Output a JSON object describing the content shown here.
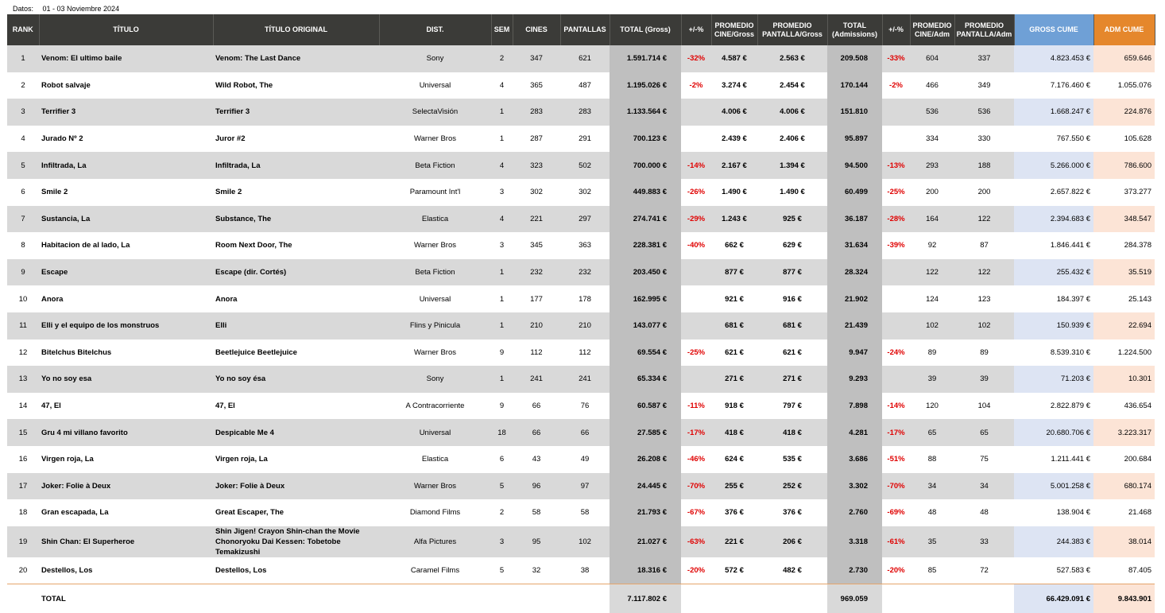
{
  "datos": {
    "label": "Datos:",
    "value": "01 - 03 Noviembre 2024"
  },
  "headers": {
    "rank": "RANK",
    "titulo": "TÍTULO",
    "original": "TÍTULO ORIGINAL",
    "dist": "DIST.",
    "sem": "SEM",
    "cines": "CINES",
    "pantallas": "PANTALLAS",
    "total_gross": "TOTAL (Gross)",
    "pct_gross": "+/-%",
    "prom_cine_gross_1": "PROMEDIO",
    "prom_cine_gross_2": "CINE/Gross",
    "prom_pant_gross_1": "PROMEDIO",
    "prom_pant_gross_2": "PANTALLA/Gross",
    "total_adm_1": "TOTAL",
    "total_adm_2": "(Admissions)",
    "pct_adm": "+/-%",
    "prom_cine_adm_1": "PROMEDIO",
    "prom_cine_adm_2": "CINE/Adm",
    "prom_pant_adm_1": "PROMEDIO",
    "prom_pant_adm_2": "PANTALLA/Adm",
    "gross_cume": "GROSS CUME",
    "adm_cume": "ADM CUME"
  },
  "rows": [
    {
      "rank": "1",
      "titulo": "Venom: El ultimo baile",
      "original": "Venom: The Last Dance",
      "dist": "Sony",
      "sem": "2",
      "cines": "347",
      "pantallas": "621",
      "gross": "1.591.714 €",
      "pct_gross": "-32%",
      "pcg": "4.587 €",
      "ppg": "2.563 €",
      "adm": "209.508",
      "pct_adm": "-33%",
      "pca": "604",
      "ppa": "337",
      "gross_cume": "4.823.453 €",
      "adm_cume": "659.646"
    },
    {
      "rank": "2",
      "titulo": "Robot salvaje",
      "original": "Wild Robot, The",
      "dist": "Universal",
      "sem": "4",
      "cines": "365",
      "pantallas": "487",
      "gross": "1.195.026 €",
      "pct_gross": "-2%",
      "pcg": "3.274 €",
      "ppg": "2.454 €",
      "adm": "170.144",
      "pct_adm": "-2%",
      "pca": "466",
      "ppa": "349",
      "gross_cume": "7.176.460 €",
      "adm_cume": "1.055.076"
    },
    {
      "rank": "3",
      "titulo": "Terrifier 3",
      "original": "Terrifier 3",
      "dist": "SelectaVisión",
      "sem": "1",
      "cines": "283",
      "pantallas": "283",
      "gross": "1.133.564 €",
      "pct_gross": "",
      "pcg": "4.006 €",
      "ppg": "4.006 €",
      "adm": "151.810",
      "pct_adm": "",
      "pca": "536",
      "ppa": "536",
      "gross_cume": "1.668.247 €",
      "adm_cume": "224.876"
    },
    {
      "rank": "4",
      "titulo": "Jurado Nº 2",
      "original": "Juror #2",
      "dist": "Warner Bros",
      "sem": "1",
      "cines": "287",
      "pantallas": "291",
      "gross": "700.123 €",
      "pct_gross": "",
      "pcg": "2.439 €",
      "ppg": "2.406 €",
      "adm": "95.897",
      "pct_adm": "",
      "pca": "334",
      "ppa": "330",
      "gross_cume": "767.550 €",
      "adm_cume": "105.628"
    },
    {
      "rank": "5",
      "titulo": "Infiltrada, La",
      "original": "Infiltrada, La",
      "dist": "Beta Fiction",
      "sem": "4",
      "cines": "323",
      "pantallas": "502",
      "gross": "700.000 €",
      "pct_gross": "-14%",
      "pcg": "2.167 €",
      "ppg": "1.394 €",
      "adm": "94.500",
      "pct_adm": "-13%",
      "pca": "293",
      "ppa": "188",
      "gross_cume": "5.266.000 €",
      "adm_cume": "786.600"
    },
    {
      "rank": "6",
      "titulo": "Smile 2",
      "original": "Smile 2",
      "dist": "Paramount Int'l",
      "sem": "3",
      "cines": "302",
      "pantallas": "302",
      "gross": "449.883 €",
      "pct_gross": "-26%",
      "pcg": "1.490 €",
      "ppg": "1.490 €",
      "adm": "60.499",
      "pct_adm": "-25%",
      "pca": "200",
      "ppa": "200",
      "gross_cume": "2.657.822 €",
      "adm_cume": "373.277"
    },
    {
      "rank": "7",
      "titulo": "Sustancia, La",
      "original": "Substance, The",
      "dist": "Elastica",
      "sem": "4",
      "cines": "221",
      "pantallas": "297",
      "gross": "274.741 €",
      "pct_gross": "-29%",
      "pcg": "1.243 €",
      "ppg": "925 €",
      "adm": "36.187",
      "pct_adm": "-28%",
      "pca": "164",
      "ppa": "122",
      "gross_cume": "2.394.683 €",
      "adm_cume": "348.547"
    },
    {
      "rank": "8",
      "titulo": "Habitacion de al lado, La",
      "original": "Room Next Door, The",
      "dist": "Warner Bros",
      "sem": "3",
      "cines": "345",
      "pantallas": "363",
      "gross": "228.381 €",
      "pct_gross": "-40%",
      "pcg": "662 €",
      "ppg": "629 €",
      "adm": "31.634",
      "pct_adm": "-39%",
      "pca": "92",
      "ppa": "87",
      "gross_cume": "1.846.441 €",
      "adm_cume": "284.378"
    },
    {
      "rank": "9",
      "titulo": "Escape",
      "original": "Escape (dir. Cortés)",
      "dist": "Beta Fiction",
      "sem": "1",
      "cines": "232",
      "pantallas": "232",
      "gross": "203.450 €",
      "pct_gross": "",
      "pcg": "877 €",
      "ppg": "877 €",
      "adm": "28.324",
      "pct_adm": "",
      "pca": "122",
      "ppa": "122",
      "gross_cume": "255.432 €",
      "adm_cume": "35.519"
    },
    {
      "rank": "10",
      "titulo": "Anora",
      "original": "Anora",
      "dist": "Universal",
      "sem": "1",
      "cines": "177",
      "pantallas": "178",
      "gross": "162.995 €",
      "pct_gross": "",
      "pcg": "921 €",
      "ppg": "916 €",
      "adm": "21.902",
      "pct_adm": "",
      "pca": "124",
      "ppa": "123",
      "gross_cume": "184.397 €",
      "adm_cume": "25.143"
    },
    {
      "rank": "11",
      "titulo": "Elli y el equipo de los monstruos",
      "original": "Elli",
      "dist": "Flins y Pinicula",
      "sem": "1",
      "cines": "210",
      "pantallas": "210",
      "gross": "143.077 €",
      "pct_gross": "",
      "pcg": "681 €",
      "ppg": "681 €",
      "adm": "21.439",
      "pct_adm": "",
      "pca": "102",
      "ppa": "102",
      "gross_cume": "150.939 €",
      "adm_cume": "22.694"
    },
    {
      "rank": "12",
      "titulo": "Bitelchus Bitelchus",
      "original": "Beetlejuice Beetlejuice",
      "dist": "Warner Bros",
      "sem": "9",
      "cines": "112",
      "pantallas": "112",
      "gross": "69.554 €",
      "pct_gross": "-25%",
      "pcg": "621 €",
      "ppg": "621 €",
      "adm": "9.947",
      "pct_adm": "-24%",
      "pca": "89",
      "ppa": "89",
      "gross_cume": "8.539.310 €",
      "adm_cume": "1.224.500"
    },
    {
      "rank": "13",
      "titulo": "Yo no soy esa",
      "original": "Yo no soy ésa",
      "dist": "Sony",
      "sem": "1",
      "cines": "241",
      "pantallas": "241",
      "gross": "65.334 €",
      "pct_gross": "",
      "pcg": "271 €",
      "ppg": "271 €",
      "adm": "9.293",
      "pct_adm": "",
      "pca": "39",
      "ppa": "39",
      "gross_cume": "71.203 €",
      "adm_cume": "10.301"
    },
    {
      "rank": "14",
      "titulo": "47, El",
      "original": "47, El",
      "dist": "A Contracorriente",
      "sem": "9",
      "cines": "66",
      "pantallas": "76",
      "gross": "60.587 €",
      "pct_gross": "-11%",
      "pcg": "918 €",
      "ppg": "797 €",
      "adm": "7.898",
      "pct_adm": "-14%",
      "pca": "120",
      "ppa": "104",
      "gross_cume": "2.822.879 €",
      "adm_cume": "436.654"
    },
    {
      "rank": "15",
      "titulo": "Gru 4 mi villano favorito",
      "original": "Despicable Me 4",
      "dist": "Universal",
      "sem": "18",
      "cines": "66",
      "pantallas": "66",
      "gross": "27.585 €",
      "pct_gross": "-17%",
      "pcg": "418 €",
      "ppg": "418 €",
      "adm": "4.281",
      "pct_adm": "-17%",
      "pca": "65",
      "ppa": "65",
      "gross_cume": "20.680.706 €",
      "adm_cume": "3.223.317"
    },
    {
      "rank": "16",
      "titulo": "Virgen roja, La",
      "original": "Virgen roja, La",
      "dist": "Elastica",
      "sem": "6",
      "cines": "43",
      "pantallas": "49",
      "gross": "26.208 €",
      "pct_gross": "-46%",
      "pcg": "624 €",
      "ppg": "535 €",
      "adm": "3.686",
      "pct_adm": "-51%",
      "pca": "88",
      "ppa": "75",
      "gross_cume": "1.211.441 €",
      "adm_cume": "200.684"
    },
    {
      "rank": "17",
      "titulo": "Joker: Folie à Deux",
      "original": "Joker: Folie à Deux",
      "dist": "Warner Bros",
      "sem": "5",
      "cines": "96",
      "pantallas": "97",
      "gross": "24.445 €",
      "pct_gross": "-70%",
      "pcg": "255 €",
      "ppg": "252 €",
      "adm": "3.302",
      "pct_adm": "-70%",
      "pca": "34",
      "ppa": "34",
      "gross_cume": "5.001.258 €",
      "adm_cume": "680.174"
    },
    {
      "rank": "18",
      "titulo": "Gran escapada, La",
      "original": "Great Escaper, The",
      "dist": "Diamond Films",
      "sem": "2",
      "cines": "58",
      "pantallas": "58",
      "gross": "21.793 €",
      "pct_gross": "-67%",
      "pcg": "376 €",
      "ppg": "376 €",
      "adm": "2.760",
      "pct_adm": "-69%",
      "pca": "48",
      "ppa": "48",
      "gross_cume": "138.904 €",
      "adm_cume": "21.468"
    },
    {
      "rank": "19",
      "titulo": "Shin Chan: El Superheroe",
      "original": "Shin Jigen! Crayon Shin-chan the Movie Chonoryoku Dai Kessen: Tobetobe Temakizushi",
      "dist": "Alfa Pictures",
      "sem": "3",
      "cines": "95",
      "pantallas": "102",
      "gross": "21.027 €",
      "pct_gross": "-63%",
      "pcg": "221 €",
      "ppg": "206 €",
      "adm": "3.318",
      "pct_adm": "-61%",
      "pca": "35",
      "ppa": "33",
      "gross_cume": "244.383 €",
      "adm_cume": "38.014"
    },
    {
      "rank": "20",
      "titulo": "Destellos, Los",
      "original": "Destellos, Los",
      "dist": "Caramel Films",
      "sem": "5",
      "cines": "32",
      "pantallas": "38",
      "gross": "18.316 €",
      "pct_gross": "-20%",
      "pcg": "572 €",
      "ppg": "482 €",
      "adm": "2.730",
      "pct_adm": "-20%",
      "pca": "85",
      "ppa": "72",
      "gross_cume": "527.583 €",
      "adm_cume": "87.405"
    }
  ],
  "total": {
    "label": "TOTAL",
    "gross": "7.117.802 €",
    "adm": "969.059",
    "gross_cume": "66.429.091 €",
    "adm_cume": "9.843.901"
  }
}
